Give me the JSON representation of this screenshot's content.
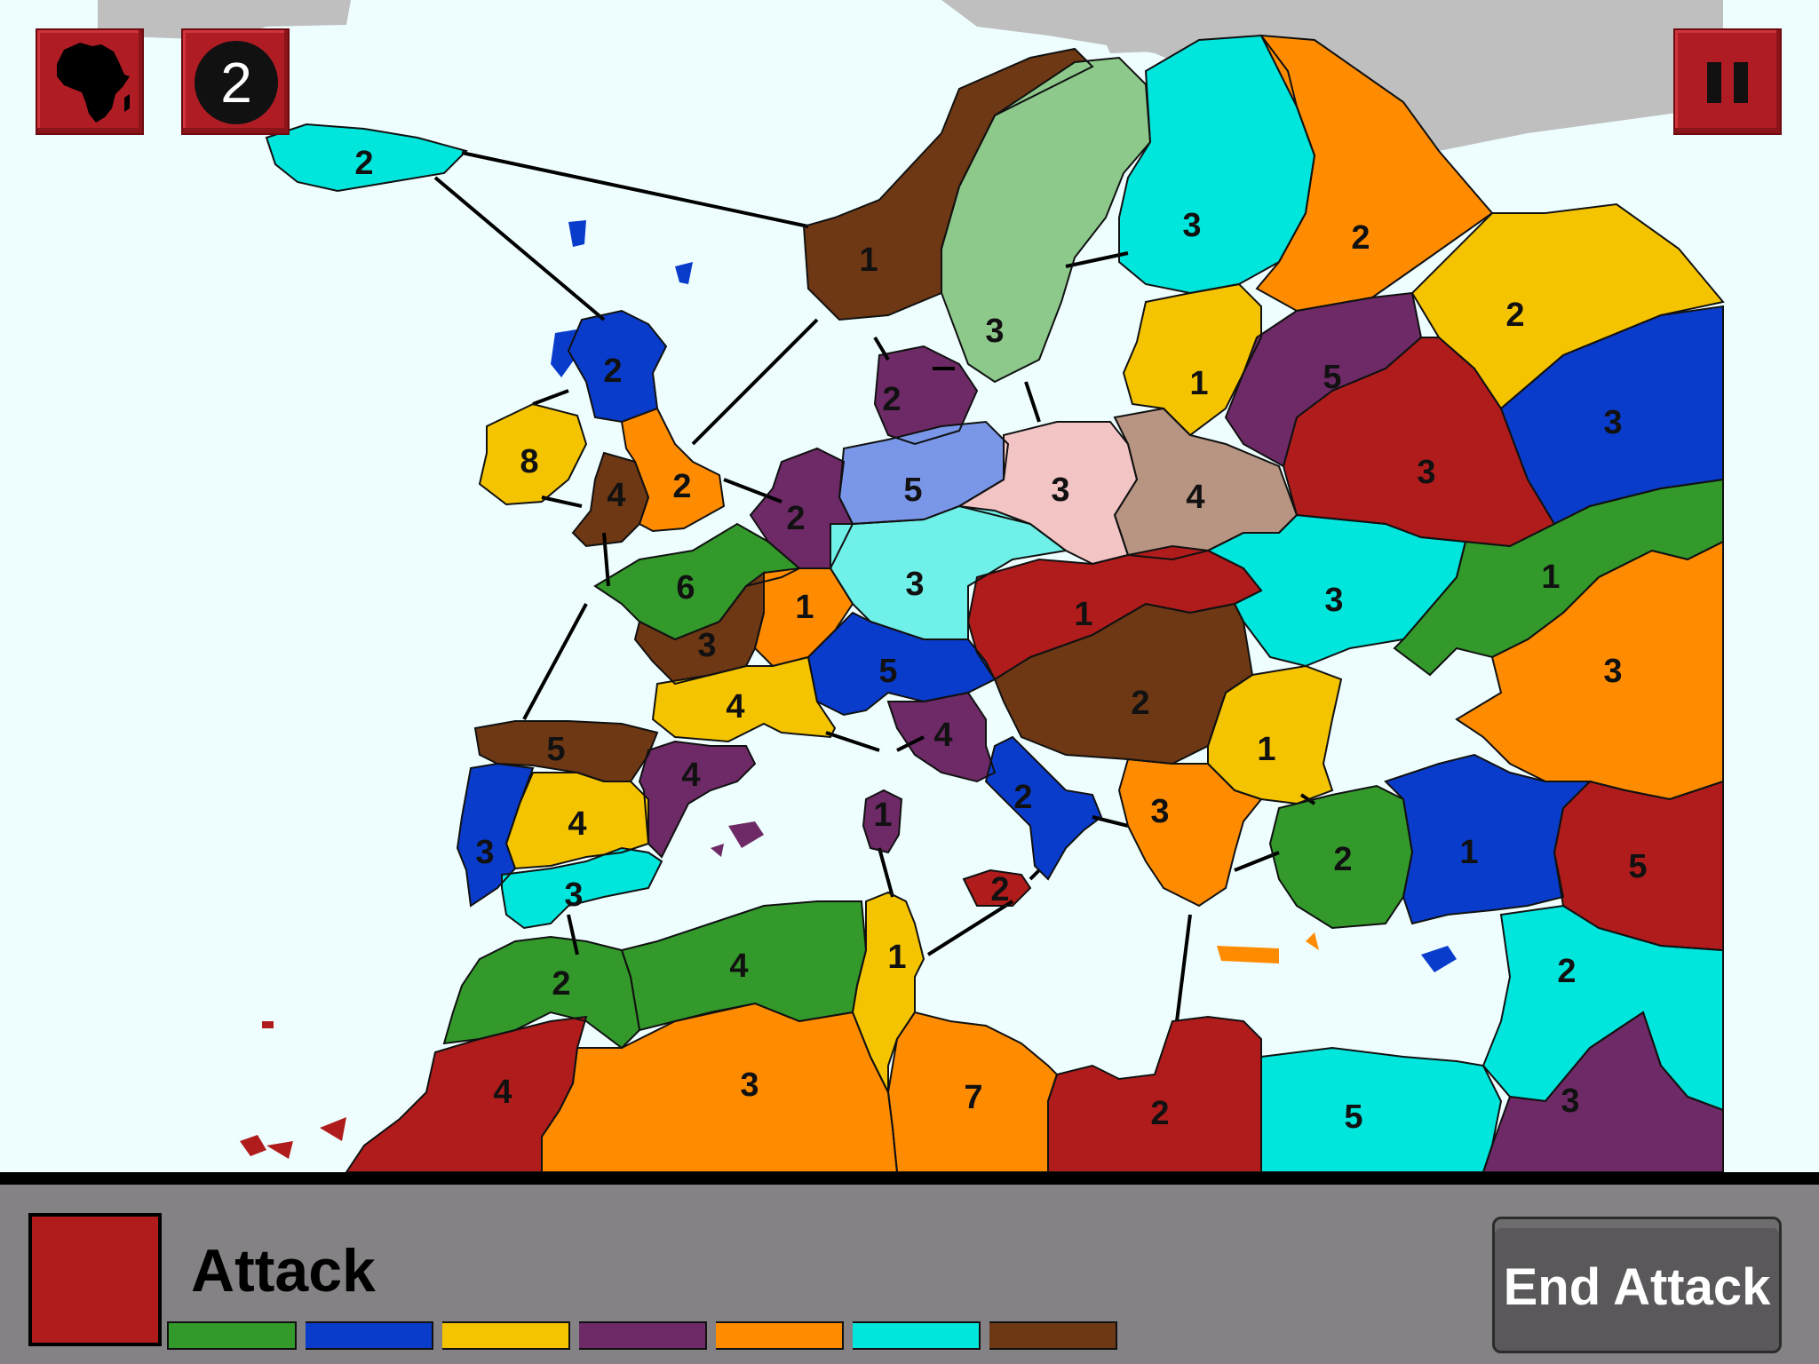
{
  "game": {
    "phase": "Attack",
    "end_button_label": "End Attack",
    "reinforcement_count": "2",
    "current_player_color": "#b01c1c"
  },
  "top_buttons": {
    "continent_icon": "africa-icon",
    "pause_icon": "pause-icon"
  },
  "player_colors": [
    "#33992b",
    "#0a3ccc",
    "#f5c400",
    "#6e2a66",
    "#ff8c00",
    "#00e5dc",
    "#6e3814"
  ],
  "territories": [
    {
      "id": "iceland",
      "color": "#00e5dc",
      "armies": "2"
    },
    {
      "id": "norway",
      "color": "#6e3814",
      "armies": "1"
    },
    {
      "id": "sweden",
      "color": "#8ec98c",
      "armies": "3"
    },
    {
      "id": "finland",
      "color": "#00e5dc",
      "armies": "3"
    },
    {
      "id": "karelia",
      "color": "#ff8c00",
      "armies": "2"
    },
    {
      "id": "komi",
      "color": "#f5c400",
      "armies": "2"
    },
    {
      "id": "scotland",
      "color": "#0a3ccc",
      "armies": "2"
    },
    {
      "id": "ireland",
      "color": "#f5c400",
      "armies": "8"
    },
    {
      "id": "wales",
      "color": "#6e3814",
      "armies": "4"
    },
    {
      "id": "england",
      "color": "#ff8c00",
      "armies": "2"
    },
    {
      "id": "denmark",
      "color": "#6e2a66",
      "armies": "2"
    },
    {
      "id": "benelux",
      "color": "#6e2a66",
      "armies": "2"
    },
    {
      "id": "north-germany",
      "color": "#7a96e8",
      "armies": "5"
    },
    {
      "id": "poland",
      "color": "#f2c4c4",
      "armies": "3"
    },
    {
      "id": "belarus",
      "color": "#b89482",
      "armies": "4"
    },
    {
      "id": "baltics",
      "color": "#f5c400",
      "armies": "1"
    },
    {
      "id": "moscow",
      "color": "#6e2a66",
      "armies": "5"
    },
    {
      "id": "volga",
      "color": "#0a3ccc",
      "armies": "3"
    },
    {
      "id": "central-russia",
      "color": "#b01c1c",
      "armies": "3"
    },
    {
      "id": "brittany",
      "color": "#33992b",
      "armies": "6"
    },
    {
      "id": "paris",
      "color": "#ff8c00",
      "armies": "1"
    },
    {
      "id": "south-germany",
      "color": "#6ff0e8",
      "armies": "3"
    },
    {
      "id": "hungary",
      "color": "#b01c1c",
      "armies": "1"
    },
    {
      "id": "ukraine",
      "color": "#00e5dc",
      "armies": "3"
    },
    {
      "id": "don",
      "color": "#33992b",
      "armies": "1"
    },
    {
      "id": "aquitaine",
      "color": "#6e3814",
      "armies": "3"
    },
    {
      "id": "switzerland",
      "color": "#0a3ccc",
      "armies": "5"
    },
    {
      "id": "balkans-north",
      "color": "#6e3814",
      "armies": "2"
    },
    {
      "id": "caucasus-north",
      "color": "#ff8c00",
      "armies": "3"
    },
    {
      "id": "southern-france",
      "color": "#f5c400",
      "armies": "4"
    },
    {
      "id": "north-italy",
      "color": "#6e2a66",
      "armies": "4"
    },
    {
      "id": "bulgaria",
      "color": "#f5c400",
      "armies": "1"
    },
    {
      "id": "galicia",
      "color": "#6e3814",
      "armies": "5"
    },
    {
      "id": "catalonia",
      "color": "#6e2a66",
      "armies": "4"
    },
    {
      "id": "castile",
      "color": "#f5c400",
      "armies": "4"
    },
    {
      "id": "portugal",
      "color": "#0a3ccc",
      "armies": "3"
    },
    {
      "id": "andalusia",
      "color": "#00e5dc",
      "armies": "3"
    },
    {
      "id": "sardinia",
      "color": "#6e2a66",
      "armies": "1"
    },
    {
      "id": "south-italy",
      "color": "#0a3ccc",
      "armies": "2"
    },
    {
      "id": "greece",
      "color": "#ff8c00",
      "armies": "3"
    },
    {
      "id": "west-anatolia",
      "color": "#33992b",
      "armies": "2"
    },
    {
      "id": "central-anatolia",
      "color": "#0a3ccc",
      "armies": "1"
    },
    {
      "id": "armenia",
      "color": "#b01c1c",
      "armies": "5"
    },
    {
      "id": "sicily",
      "color": "#b01c1c",
      "armies": "2"
    },
    {
      "id": "morocco",
      "color": "#33992b",
      "armies": "2"
    },
    {
      "id": "algeria-north",
      "color": "#33992b",
      "armies": "4"
    },
    {
      "id": "tunisia",
      "color": "#f5c400",
      "armies": "1"
    },
    {
      "id": "syria",
      "color": "#00e5dc",
      "armies": "2"
    },
    {
      "id": "western-sahara",
      "color": "#b01c1c",
      "armies": "4"
    },
    {
      "id": "algeria-south",
      "color": "#ff8c00",
      "armies": "3"
    },
    {
      "id": "libya-west",
      "color": "#ff8c00",
      "armies": "7"
    },
    {
      "id": "libya-east",
      "color": "#b01c1c",
      "armies": "2"
    },
    {
      "id": "egypt",
      "color": "#00e5dc",
      "armies": "5"
    },
    {
      "id": "arabia",
      "color": "#6e2a66",
      "armies": "3"
    }
  ]
}
